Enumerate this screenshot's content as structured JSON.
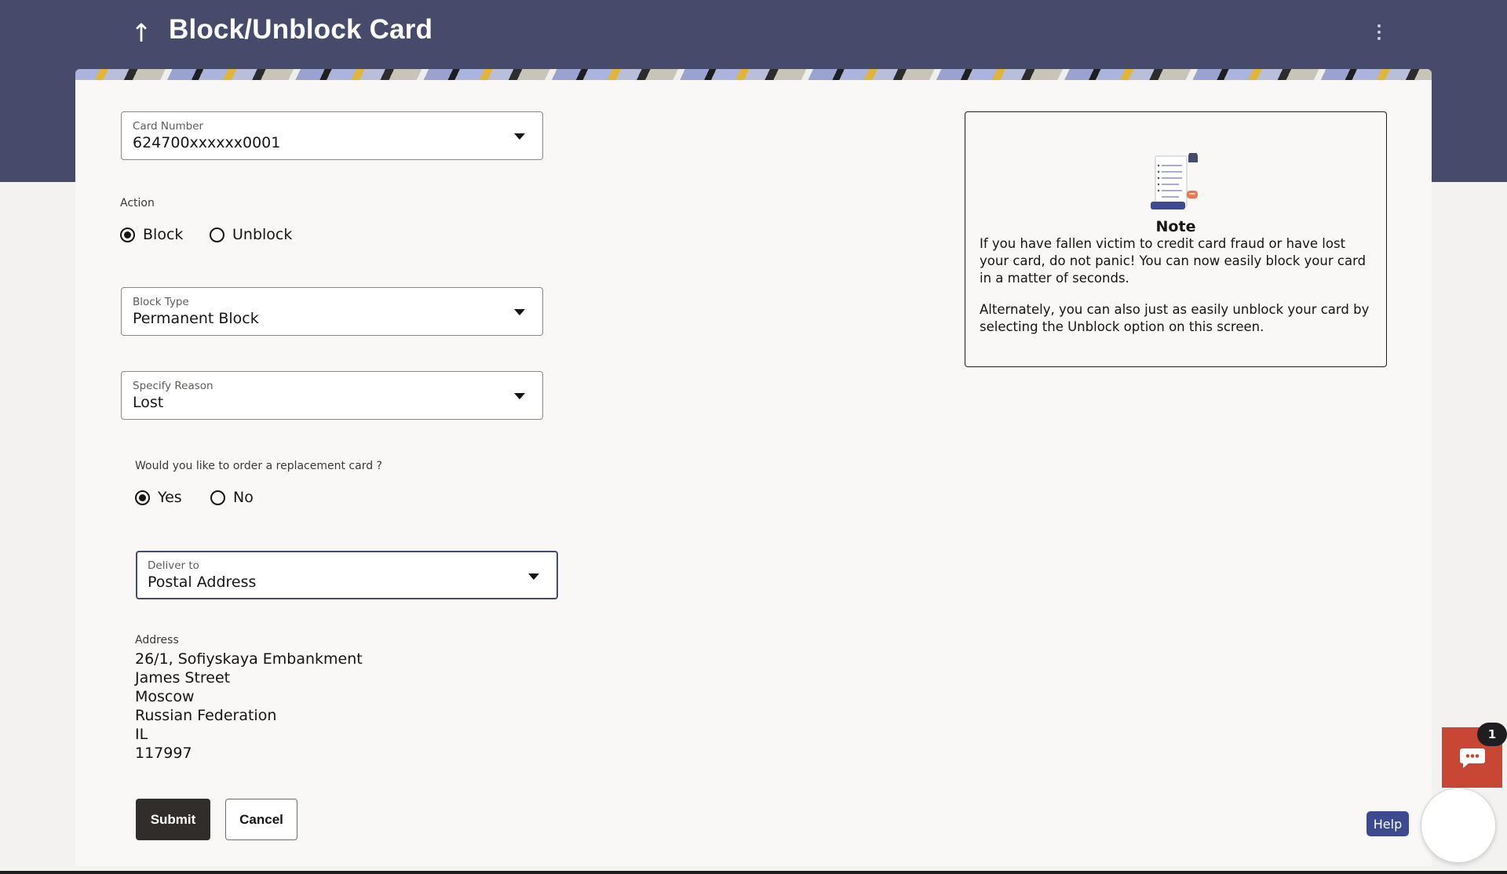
{
  "header": {
    "title": "Block/Unblock Card"
  },
  "form": {
    "card_number": {
      "label": "Card Number",
      "value": "624700xxxxxx0001"
    },
    "action": {
      "label": "Action",
      "options": [
        {
          "label": "Block",
          "selected": true
        },
        {
          "label": "Unblock",
          "selected": false
        }
      ]
    },
    "block_type": {
      "label": "Block Type",
      "value": "Permanent Block"
    },
    "reason": {
      "label": "Specify Reason",
      "value": "Lost"
    },
    "replacement": {
      "label": "Would you like to order a replacement card ?",
      "options": [
        {
          "label": "Yes",
          "selected": true
        },
        {
          "label": "No",
          "selected": false
        }
      ]
    },
    "deliver_to": {
      "label": "Deliver to",
      "value": "Postal Address"
    },
    "address": {
      "label": "Address",
      "lines": [
        "26/1, Sofiyskaya Embankment",
        "James Street",
        "Moscow",
        "Russian Federation",
        "IL",
        "117997"
      ]
    },
    "submit_label": "Submit",
    "cancel_label": "Cancel"
  },
  "note": {
    "title": "Note",
    "paragraphs": [
      "If you have fallen victim to credit card fraud or have lost your card, do not panic! You can now easily block your card in a matter of seconds.",
      "Alternately, you can also just as easily unblock your card by selecting the Unblock option on this screen."
    ]
  },
  "chat": {
    "badge_count": "1"
  },
  "help": {
    "label": "Help"
  },
  "colors": {
    "header": "#474b6b",
    "primary_button": "#312d2a",
    "chat": "#c74634",
    "help": "#3d4a8f"
  }
}
